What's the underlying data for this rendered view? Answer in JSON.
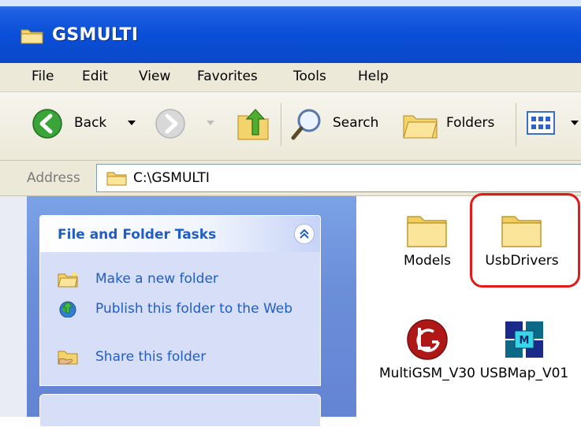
{
  "window": {
    "title": "GSMULTI"
  },
  "menu": [
    "File",
    "Edit",
    "View",
    "Favorites",
    "Tools",
    "Help"
  ],
  "toolbar": {
    "back_label": "Back",
    "search_label": "Search",
    "folders_label": "Folders"
  },
  "address": {
    "label": "Address",
    "path": "C:\\GSMULTI"
  },
  "tasks": {
    "heading": "File and Folder Tasks",
    "items": [
      {
        "label": "Make a new folder",
        "icon": "new-folder-icon"
      },
      {
        "label": "Publish this folder to the Web",
        "icon": "publish-web-icon"
      },
      {
        "label": "Share this folder",
        "icon": "share-folder-icon"
      }
    ]
  },
  "files": [
    {
      "name": "Models",
      "icon": "folder-icon"
    },
    {
      "name": "UsbDrivers",
      "icon": "folder-icon"
    },
    {
      "name": "MultiGSM_V30",
      "icon": "lg-logo-icon"
    },
    {
      "name": "USBMap_V01",
      "icon": "usbmap-app-icon"
    }
  ],
  "colors": {
    "titlebar": "#0a4fd8",
    "task_text": "#215dc6",
    "highlight": "#e21a1a"
  }
}
